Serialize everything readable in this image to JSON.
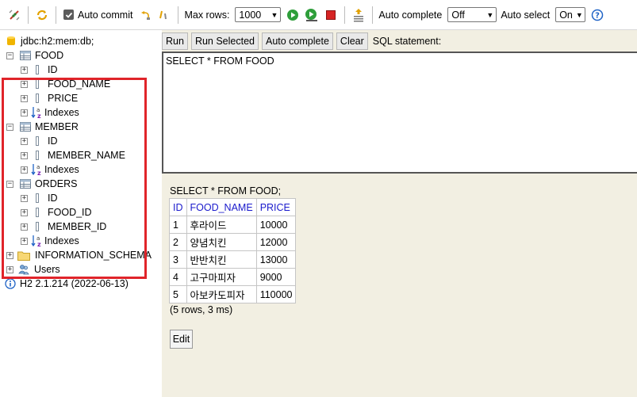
{
  "toolbar": {
    "auto_commit_label": "Auto commit",
    "max_rows_label": "Max rows:",
    "max_rows_value": "1000",
    "auto_complete_label": "Auto complete",
    "auto_complete_value": "Off",
    "auto_select_label": "Auto select",
    "auto_select_value": "On",
    "help_symbol": "?"
  },
  "tree": {
    "connection": "jdbc:h2:mem:db;",
    "tables": [
      {
        "name": "FOOD",
        "columns": [
          "ID",
          "FOOD_NAME",
          "PRICE"
        ],
        "indexes": "Indexes"
      },
      {
        "name": "MEMBER",
        "columns": [
          "ID",
          "MEMBER_NAME"
        ],
        "indexes": "Indexes"
      },
      {
        "name": "ORDERS",
        "columns": [
          "ID",
          "FOOD_ID",
          "MEMBER_ID"
        ],
        "indexes": "Indexes"
      }
    ],
    "information_schema": "INFORMATION_SCHEMA",
    "users": "Users",
    "version": "H2 2.1.214 (2022-06-13)"
  },
  "buttons": {
    "run": "Run",
    "run_selected": "Run Selected",
    "auto_complete": "Auto complete",
    "clear": "Clear",
    "sql_statement": "SQL statement:"
  },
  "sql_text": "SELECT * FROM FOOD",
  "result": {
    "query": "SELECT * FROM FOOD;",
    "headers": [
      "ID",
      "FOOD_NAME",
      "PRICE"
    ],
    "rows": [
      [
        "1",
        "후라이드",
        "10000"
      ],
      [
        "2",
        "양념치킨",
        "12000"
      ],
      [
        "3",
        "반반치킨",
        "13000"
      ],
      [
        "4",
        "고구마피자",
        "9000"
      ],
      [
        "5",
        "아보카도피자",
        "110000"
      ]
    ],
    "rows_info": "(5 rows, 3 ms)",
    "edit": "Edit"
  },
  "colors": {
    "highlight": "#e0242a",
    "header_text": "#1a1acc",
    "panel_bg": "#f2efe2"
  }
}
